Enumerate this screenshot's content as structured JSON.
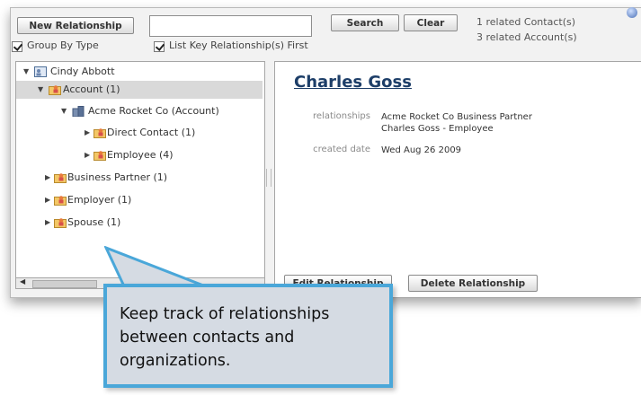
{
  "toolbar": {
    "new_relationship_label": "New Relationship",
    "search_value": "",
    "search_label": "Search",
    "clear_label": "Clear",
    "group_by_type_label": "Group By Type",
    "group_by_type_checked": true,
    "list_key_label": "List Key Relationship(s) First",
    "list_key_checked": true,
    "related_contacts": "1 related Contact(s)",
    "related_accounts": "3 related Account(s)"
  },
  "tree": {
    "nodes": [
      {
        "label": "Cindy Abbott",
        "icon": "contact-card-icon",
        "expanded": true
      },
      {
        "label": "Account (1)",
        "icon": "folder-person-icon",
        "expanded": true,
        "selected": true
      },
      {
        "label": "Acme Rocket Co (Account)",
        "icon": "building-icon",
        "expanded": true
      },
      {
        "label": "Direct Contact (1)",
        "icon": "folder-person-icon",
        "expanded": false
      },
      {
        "label": "Employee (4)",
        "icon": "folder-person-icon",
        "expanded": false
      },
      {
        "label": "Business Partner (1)",
        "icon": "folder-person-icon",
        "expanded": false
      },
      {
        "label": "Employer (1)",
        "icon": "folder-person-icon",
        "expanded": false
      },
      {
        "label": "Spouse (1)",
        "icon": "folder-person-icon",
        "expanded": false
      }
    ]
  },
  "detail": {
    "name": "Charles Goss",
    "relationships_label": "relationships",
    "relationships_line1": "Acme Rocket Co   Business Partner",
    "relationships_line2": "Charles Goss - Employee",
    "created_label": "created date",
    "created_value": "Wed Aug 26 2009",
    "edit_label": "Edit Relationship",
    "delete_label": "Delete Relationship"
  },
  "callout": {
    "text": "Keep track of relationships between contacts and organizations."
  },
  "colors": {
    "callout_border": "#4aa7d9",
    "callout_fill": "#d5dbe3",
    "name_link": "#1d3e68"
  }
}
